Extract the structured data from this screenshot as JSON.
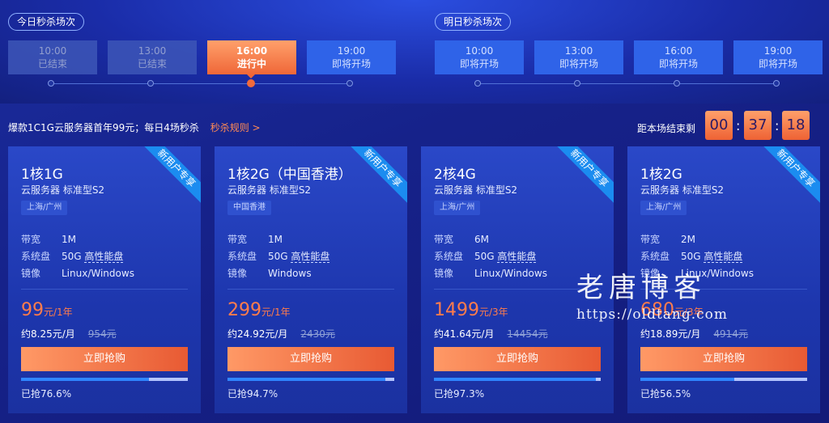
{
  "today_label": "今日秒杀场次",
  "tomorrow_label": "明日秒杀场次",
  "today_slots": [
    {
      "time": "10:00",
      "status": "已结束",
      "state": "ended"
    },
    {
      "time": "13:00",
      "status": "已结束",
      "state": "ended"
    },
    {
      "time": "16:00",
      "status": "进行中",
      "state": "active"
    },
    {
      "time": "19:00",
      "status": "即将开场",
      "state": "upcoming"
    }
  ],
  "tomorrow_slots": [
    {
      "time": "10:00",
      "status": "即将开场",
      "state": "upcoming"
    },
    {
      "time": "13:00",
      "status": "即将开场",
      "state": "upcoming"
    },
    {
      "time": "16:00",
      "status": "即将开场",
      "state": "upcoming"
    },
    {
      "time": "19:00",
      "status": "即将开场",
      "state": "upcoming"
    }
  ],
  "promo": {
    "text": "爆款1C1G云服务器首年99元；每日4场秒杀",
    "rules_link": "秒杀规则 >"
  },
  "countdown": {
    "label": "距本场结束剩",
    "hours": "00",
    "minutes": "37",
    "seconds": "18",
    "separator": ":"
  },
  "spec_labels": {
    "bandwidth": "带宽",
    "disk": "系统盘",
    "image": "镜像"
  },
  "cards": [
    {
      "ribbon": "新用户专享",
      "title": "1核1G",
      "subtitle": "云服务器 标准型S2",
      "region": "上海/广州",
      "bandwidth": "1M",
      "disk_size": "50G",
      "disk_type": "高性能盘",
      "image": "Linux/Windows",
      "price": "99",
      "price_unit": "元/1年",
      "monthly": "约8.25元/月",
      "original": "954元",
      "buy_label": "立即抢购",
      "progress": 76.6,
      "sold_text": "已抢76.6%"
    },
    {
      "ribbon": "新用户专享",
      "title": "1核2G（中国香港）",
      "subtitle": "云服务器 标准型S2",
      "region": "中国香港",
      "bandwidth": "1M",
      "disk_size": "50G",
      "disk_type": "高性能盘",
      "image": "Windows",
      "price": "299",
      "price_unit": "元/1年",
      "monthly": "约24.92元/月",
      "original": "2430元",
      "buy_label": "立即抢购",
      "progress": 94.7,
      "sold_text": "已抢94.7%"
    },
    {
      "ribbon": "新用户专享",
      "title": "2核4G",
      "subtitle": "云服务器 标准型S2",
      "region": "上海/广州",
      "bandwidth": "6M",
      "disk_size": "50G",
      "disk_type": "高性能盘",
      "image": "Linux/Windows",
      "price": "1499",
      "price_unit": "元/3年",
      "monthly": "约41.64元/月",
      "original": "14454元",
      "buy_label": "立即抢购",
      "progress": 97.3,
      "sold_text": "已抢97.3%"
    },
    {
      "ribbon": "新用户专享",
      "title": "1核2G",
      "subtitle": "云服务器 标准型S2",
      "region": "上海/广州",
      "bandwidth": "2M",
      "disk_size": "50G",
      "disk_type": "高性能盘",
      "image": "Linux/Windows",
      "price": "680",
      "price_unit": "元/3年",
      "monthly": "约18.89元/月",
      "original": "4914元",
      "buy_label": "立即抢购",
      "progress": 56.5,
      "sold_text": "已抢56.5%"
    }
  ],
  "watermark": {
    "title": "老唐博客",
    "url": "https://oldtang.com"
  }
}
